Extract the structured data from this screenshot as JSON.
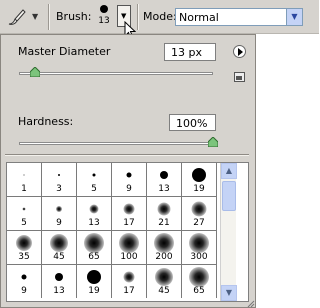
{
  "toolbar": {
    "tool_icon": "brush-tool-icon",
    "brush_label": "Brush:",
    "brush_size": "13",
    "mode_label": "Mode:",
    "mode_value": "Normal"
  },
  "panel": {
    "master_diameter_label": "Master Diameter",
    "master_diameter_value": "13 px",
    "master_diameter_slider": 0.08,
    "hardness_label": "Hardness:",
    "hardness_value": "100%",
    "hardness_slider": 1.0,
    "presets": [
      {
        "label": "1",
        "size": 1,
        "soft": false
      },
      {
        "label": "3",
        "size": 2,
        "soft": false
      },
      {
        "label": "5",
        "size": 3,
        "soft": false
      },
      {
        "label": "9",
        "size": 5,
        "soft": false
      },
      {
        "label": "13",
        "size": 8,
        "soft": false
      },
      {
        "label": "19",
        "size": 14,
        "soft": false
      },
      {
        "label": "5",
        "size": 3,
        "soft": true
      },
      {
        "label": "9",
        "size": 6,
        "soft": true
      },
      {
        "label": "13",
        "size": 9,
        "soft": true
      },
      {
        "label": "17",
        "size": 11,
        "soft": true
      },
      {
        "label": "21",
        "size": 13,
        "soft": true
      },
      {
        "label": "27",
        "size": 15,
        "soft": true
      },
      {
        "label": "35",
        "size": 16,
        "soft": true
      },
      {
        "label": "45",
        "size": 18,
        "soft": true
      },
      {
        "label": "65",
        "size": 20,
        "soft": true
      },
      {
        "label": "100",
        "size": 20,
        "soft": true
      },
      {
        "label": "200",
        "size": 20,
        "soft": true
      },
      {
        "label": "300",
        "size": 20,
        "soft": true
      },
      {
        "label": "9",
        "size": 5,
        "soft": false
      },
      {
        "label": "13",
        "size": 8,
        "soft": false
      },
      {
        "label": "19",
        "size": 14,
        "soft": false
      },
      {
        "label": "17",
        "size": 11,
        "soft": true
      },
      {
        "label": "45",
        "size": 18,
        "soft": true
      },
      {
        "label": "65",
        "size": 20,
        "soft": true
      }
    ]
  }
}
